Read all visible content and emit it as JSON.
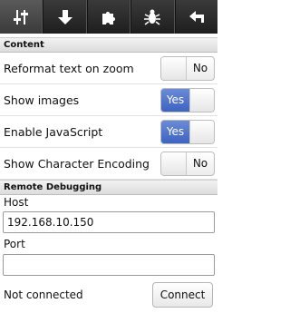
{
  "toolbar": {
    "buttons": [
      {
        "icon": "sliders-icon",
        "active": true
      },
      {
        "icon": "arrow-down-icon",
        "active": false
      },
      {
        "icon": "puzzle-icon",
        "active": false
      },
      {
        "icon": "bug-icon",
        "active": false
      },
      {
        "icon": "back-arrow-icon",
        "active": false
      }
    ]
  },
  "content": {
    "header": "Content",
    "items": [
      {
        "label": "Reformat text on zoom",
        "state": "No"
      },
      {
        "label": "Show images",
        "state": "Yes"
      },
      {
        "label": "Enable JavaScript",
        "state": "Yes"
      },
      {
        "label": "Show Character Encoding",
        "state": "No"
      }
    ]
  },
  "remote": {
    "header": "Remote Debugging",
    "host_label": "Host",
    "host_value": "192.168.10.150",
    "port_label": "Port",
    "port_value": "",
    "status": "Not connected",
    "connect_label": "Connect"
  },
  "colors": {
    "toggle_on": "#4a6fca",
    "toolbar": "#2a2a2a"
  }
}
